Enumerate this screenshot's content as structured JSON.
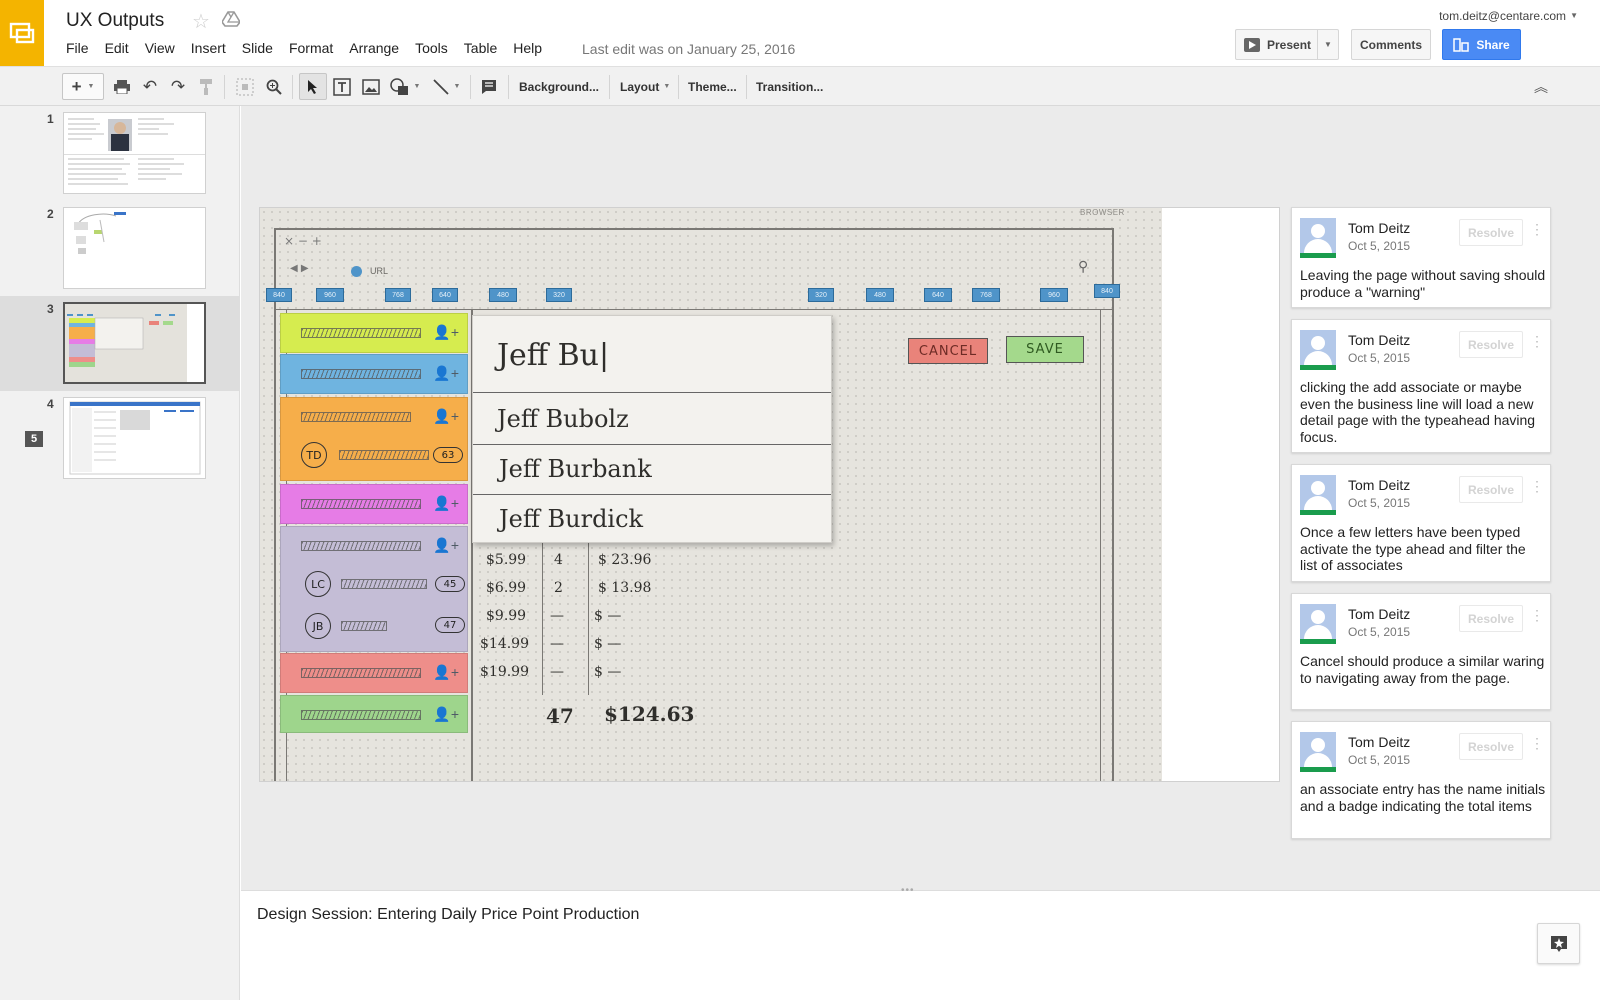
{
  "header": {
    "title": "UX Outputs",
    "menu": [
      "File",
      "Edit",
      "View",
      "Insert",
      "Slide",
      "Format",
      "Arrange",
      "Tools",
      "Table",
      "Help"
    ],
    "last_edit": "Last edit was on January 25, 2016",
    "user_email": "tom.deitz@centare.com",
    "present_label": "Present",
    "comments_label": "Comments",
    "share_label": "Share",
    "brand_color": "#f4b400",
    "share_color": "#4a8af4"
  },
  "toolbar": {
    "background": "Background...",
    "layout": "Layout",
    "theme": "Theme...",
    "transition": "Transition..."
  },
  "slides": {
    "numbers": [
      "1",
      "2",
      "3",
      "4"
    ],
    "selected_index": 3,
    "comment_count": "5"
  },
  "sketch": {
    "browser_label": "BROWSER",
    "url_label": "URL",
    "breakpoints_left": [
      "840",
      "960",
      "768",
      "640",
      "480",
      "320"
    ],
    "breakpoints_right": [
      "320",
      "480",
      "640",
      "768",
      "960",
      "840"
    ],
    "typeahead_query": "Jeff Bu|",
    "typeahead_options": [
      "Jeff Bubolz",
      "Jeff Burbank",
      "Jeff Burdick"
    ],
    "cancel_label": "CANCEL",
    "save_label": "SAVE",
    "initials": [
      "TD",
      "LC",
      "JB"
    ],
    "counts": [
      "63",
      "45",
      "47"
    ],
    "prices": [
      "$5.99",
      "$6.99",
      "$9.99",
      "$14.99",
      "$19.99"
    ],
    "qty": [
      "4",
      "2",
      "—",
      "—",
      "—"
    ],
    "totals": [
      "$ 23.96",
      "$ 13.98",
      "$ —",
      "$ —",
      "$ —"
    ],
    "grand_qty": "47",
    "grand_total": "$124.63"
  },
  "comments": [
    {
      "author": "Tom Deitz",
      "date": "Oct 5, 2015",
      "resolve": "Resolve",
      "text": "Leaving the page without saving should produce a \"warning\""
    },
    {
      "author": "Tom Deitz",
      "date": "Oct 5, 2015",
      "resolve": "Resolve",
      "text": "clicking the add associate or maybe even the business line will load a new detail page with the typeahead having focus."
    },
    {
      "author": "Tom Deitz",
      "date": "Oct 5, 2015",
      "resolve": "Resolve",
      "text": "Once a few letters have been typed activate the type ahead and filter the list of associates"
    },
    {
      "author": "Tom Deitz",
      "date": "Oct 5, 2015",
      "resolve": "Resolve",
      "text": "Cancel should produce a similar waring to navigating away from the page."
    },
    {
      "author": "Tom Deitz",
      "date": "Oct 5, 2015",
      "resolve": "Resolve",
      "text": "an associate entry has the name initials and a badge indicating the total items"
    }
  ],
  "notes": {
    "text": "Design Session: Entering Daily Price Point Production"
  }
}
